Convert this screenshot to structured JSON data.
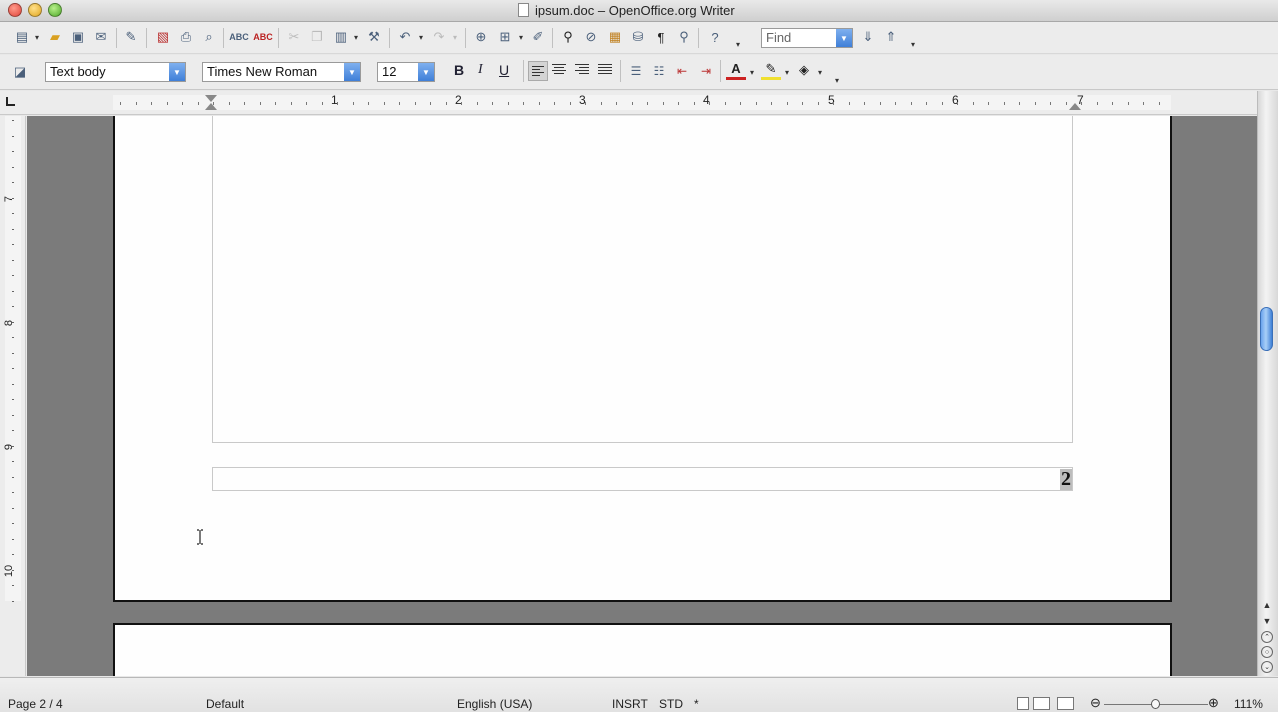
{
  "window": {
    "title": "ipsum.doc – OpenOffice.org Writer"
  },
  "toolbar_standard": {
    "icons": [
      "new-icon",
      "open-icon",
      "save-icon",
      "email-icon",
      "edit-file-icon",
      "pdf-icon",
      "print-icon",
      "print-preview-icon",
      "spellcheck-icon",
      "autospellcheck-icon",
      "cut-icon",
      "copy-icon",
      "paste-icon",
      "clone-format-icon",
      "undo-icon",
      "redo-icon",
      "hyperlink-icon",
      "table-icon",
      "draw-functions-icon",
      "find-replace-icon",
      "navigator-icon",
      "gallery-icon",
      "data-sources-icon",
      "nonprinting-characters-icon",
      "zoom-icon",
      "help-icon"
    ],
    "find": {
      "placeholder": "Find"
    }
  },
  "toolbar_formatting": {
    "paragraph_style": "Text body",
    "font_name": "Times New Roman",
    "font_size": "12",
    "bold_label": "B",
    "italic_label": "I",
    "underline_label": "U"
  },
  "ruler": {
    "h_numbers": [
      "1",
      "2",
      "3",
      "4",
      "5",
      "6",
      "7"
    ],
    "v_numbers": [
      "7",
      "8",
      "9",
      "10"
    ]
  },
  "document": {
    "page_number_field": "2"
  },
  "statusbar": {
    "page": "Page 2 / 4",
    "page_style": "Default",
    "language": "English (USA)",
    "insert_mode": "INSRT",
    "selection_mode": "STD",
    "modified": "*",
    "zoom": "111%"
  }
}
